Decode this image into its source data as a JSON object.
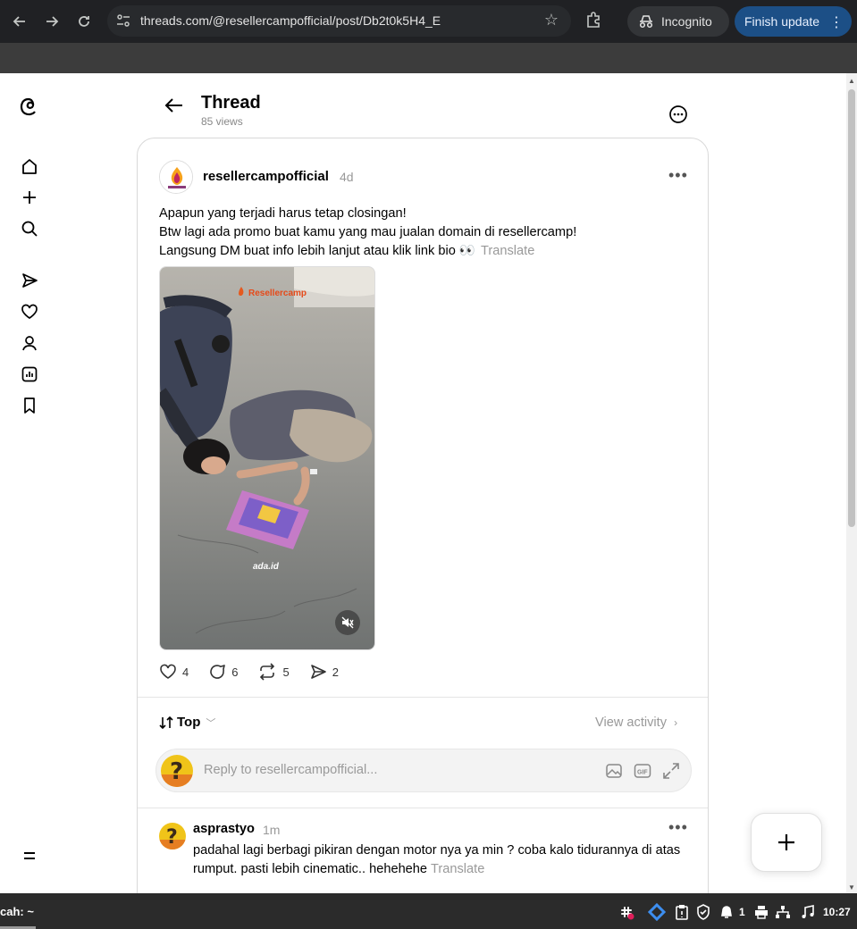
{
  "browser": {
    "url": "threads.com/@resellercampofficial/post/Db2t0k5H4_E",
    "incognito_label": "Incognito",
    "finish_update_label": "Finish update"
  },
  "header": {
    "title": "Thread",
    "views": "85 views"
  },
  "post": {
    "username": "resellercampofficial",
    "time": "4d",
    "lines": [
      "Apapun yang terjadi harus tetap closingan!",
      "Btw lagi ada promo buat kamu yang mau jualan domain di resellercamp!",
      "Langsung DM buat info lebih lanjut atau klik link bio 👀"
    ],
    "translate_label": "Translate",
    "media_watermark": "ada.id",
    "media_brand": "Resellercamp",
    "counts": {
      "likes": "4",
      "replies": "6",
      "reposts": "5",
      "shares": "2"
    }
  },
  "sort": {
    "label": "Top",
    "view_activity": "View activity"
  },
  "reply": {
    "placeholder": "Reply to resellercampofficial..."
  },
  "comment": {
    "username": "asprastyo",
    "time": "1m",
    "text": "padahal lagi berbagi pikiran dengan motor nya ya min ? coba kalo tidurannya di atas rumput. pasti lebih cinematic.. hehehehe",
    "translate_label": "Translate"
  },
  "taskbar": {
    "left_label": "cah: ~",
    "notif_count": "1",
    "clock": "10:27"
  },
  "colors": {
    "finish_update_bg": "#1c4f86",
    "chrome_bg": "#202124"
  }
}
